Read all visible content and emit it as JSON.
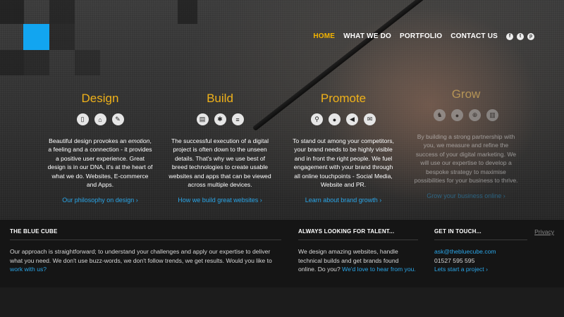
{
  "logo": {
    "color": "#12a5f0"
  },
  "nav": {
    "items": [
      "HOME",
      "WHAT WE DO",
      "PORTFOLIO",
      "CONTACT US"
    ],
    "active": "HOME",
    "social": [
      "facebook-icon",
      "twitter-icon",
      "pinterest-icon"
    ]
  },
  "services": [
    {
      "title": "Design",
      "icons": [
        "mobile-icon",
        "basket-icon",
        "design-tools-icon"
      ],
      "text": "Beautiful design provokes an emotion, a feeling and a connection - it provides a positive user experience. Great design is in our DNA, it's at the heart of what we do. Websites, E-commerce and Apps.",
      "link": "Our philosophy on design  ›"
    },
    {
      "title": "Build",
      "icons": [
        "document-icon",
        "gear-icon",
        "database-icon"
      ],
      "text": "The successful execution of a digital project is often down to the unseen details. That's why we use best of breed technologies to create usable websites and apps that can be viewed across multiple devices.",
      "link": "How we build great websites  ›"
    },
    {
      "title": "Promote",
      "icons": [
        "search-icon",
        "chat-icon",
        "megaphone-icon",
        "mail-icon"
      ],
      "text": "To stand out among your competitors, your brand needs to be highly visible and in front the right people. We fuel engagement with your brand through all online touchpoints - Social Media, Website and PR.",
      "link": "Learn about brand growth  ›"
    },
    {
      "title": "Grow",
      "icons": [
        "chess-icon",
        "people-icon",
        "target-icon",
        "chart-icon"
      ],
      "text": "By building a strong partnership with you, we measure and refine the success of your digital marketing. We will use our expertise to develop a bespoke strategy to maximise possibilities for your business to thrive.",
      "link": "Grow your business online  ›"
    }
  ],
  "footer": {
    "about": {
      "title": "THE BLUE CUBE",
      "text": "Our approach is straightforward; to understand your challenges and apply our expertise to deliver what you need. We don't use buzz-words, we don't follow trends, we get results. Would you like to",
      "link": "work with us?"
    },
    "talent": {
      "title": "ALWAYS LOOKING FOR TALENT...",
      "text": "We design amazing websites, handle technical builds and get brands found online. Do you?",
      "link": "We'd love to hear from you."
    },
    "contact": {
      "title": "GET IN TOUCH...",
      "email": "ask@thebluecube.com",
      "phone": "01527 595 595",
      "link": "Lets start a project  ›"
    },
    "privacy": "Privacy"
  }
}
